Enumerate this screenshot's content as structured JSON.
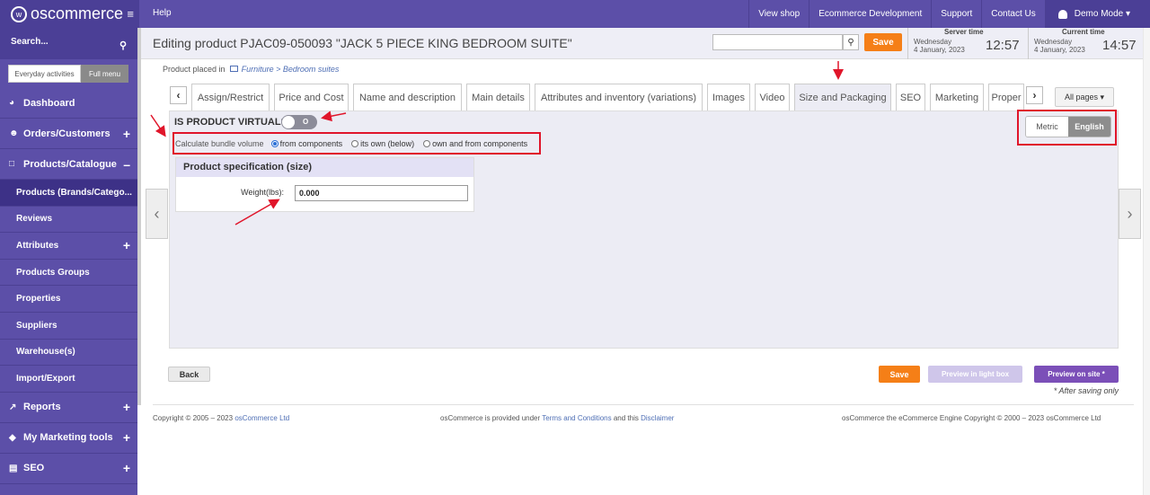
{
  "topbar": {
    "logo_text": "oscommerce",
    "help": "Help",
    "links": [
      "View shop",
      "Ecommerce Development",
      "Support",
      "Contact Us"
    ],
    "user": "Demo Mode ▾"
  },
  "sidebar": {
    "search_label": "Search...",
    "mode_everyday": "Everyday activities",
    "mode_full": "Full menu",
    "dashboard": "Dashboard",
    "orders": "Orders/Customers",
    "products": "Products/Catalogue",
    "sub_items": [
      "Products (Brands/Catego...",
      "Reviews",
      "Attributes",
      "Products Groups",
      "Properties",
      "Suppliers",
      "Warehouse(s)",
      "Import/Export"
    ],
    "reports": "Reports",
    "marketing": "My Marketing tools",
    "seo": "SEO"
  },
  "header": {
    "title": "Editing product PJAC09-050093 \"JACK 5 PIECE KING BEDROOM SUITE\"",
    "save": "Save",
    "server_time_label": "Server time",
    "server_day": "Wednesday",
    "server_date": "4 January, 2023",
    "server_time": "12:57",
    "current_time_label": "Current time",
    "current_day": "Wednesday",
    "current_date": "4 January, 2023",
    "current_time": "14:57"
  },
  "breadcrumb": {
    "prefix": "Product placed in",
    "path1": "Furniture",
    "sep": " > ",
    "path2": "Bedroom suites"
  },
  "tabs": [
    "Assign/Restrict",
    "Price and Cost",
    "Name and description",
    "Main details",
    "Attributes and inventory (variations)",
    "Images",
    "Video",
    "Size and Packaging",
    "SEO",
    "Marketing",
    "Proper"
  ],
  "all_pages": "All pages ▾",
  "form": {
    "virtual_label": "IS PRODUCT VIRTUAL?",
    "virtual_value": "O",
    "bundle_label": "Calculate bundle volume",
    "bundle_options": [
      "from components",
      "its own (below)",
      "own and from components"
    ],
    "bundle_selected": 0,
    "spec_title": "Product specification (size)",
    "weight_label": "Weight(lbs):",
    "weight_value": "0.000",
    "unit_metric": "Metric",
    "unit_english": "English"
  },
  "footer": {
    "back": "Back",
    "save": "Save",
    "preview_lightbox": "Preview in light box",
    "preview_site": "Preview on site *",
    "after_note": "* After saving only",
    "copyright_prefix": "Copyright © 2005 – 2023",
    "copyright_link": "osCommerce Ltd",
    "provided_prefix": "osCommerce is provided under",
    "terms": "Terms and Conditions",
    "provided_mid": "and this",
    "disclaimer": "Disclaimer",
    "engine": "osCommerce the eCommerce Engine Copyright © 2000 – 2023 osCommerce Ltd"
  },
  "colors": {
    "sidebar": "#5c4fa8",
    "accent_orange": "#f57f17",
    "annotation_red": "#e0152a"
  }
}
